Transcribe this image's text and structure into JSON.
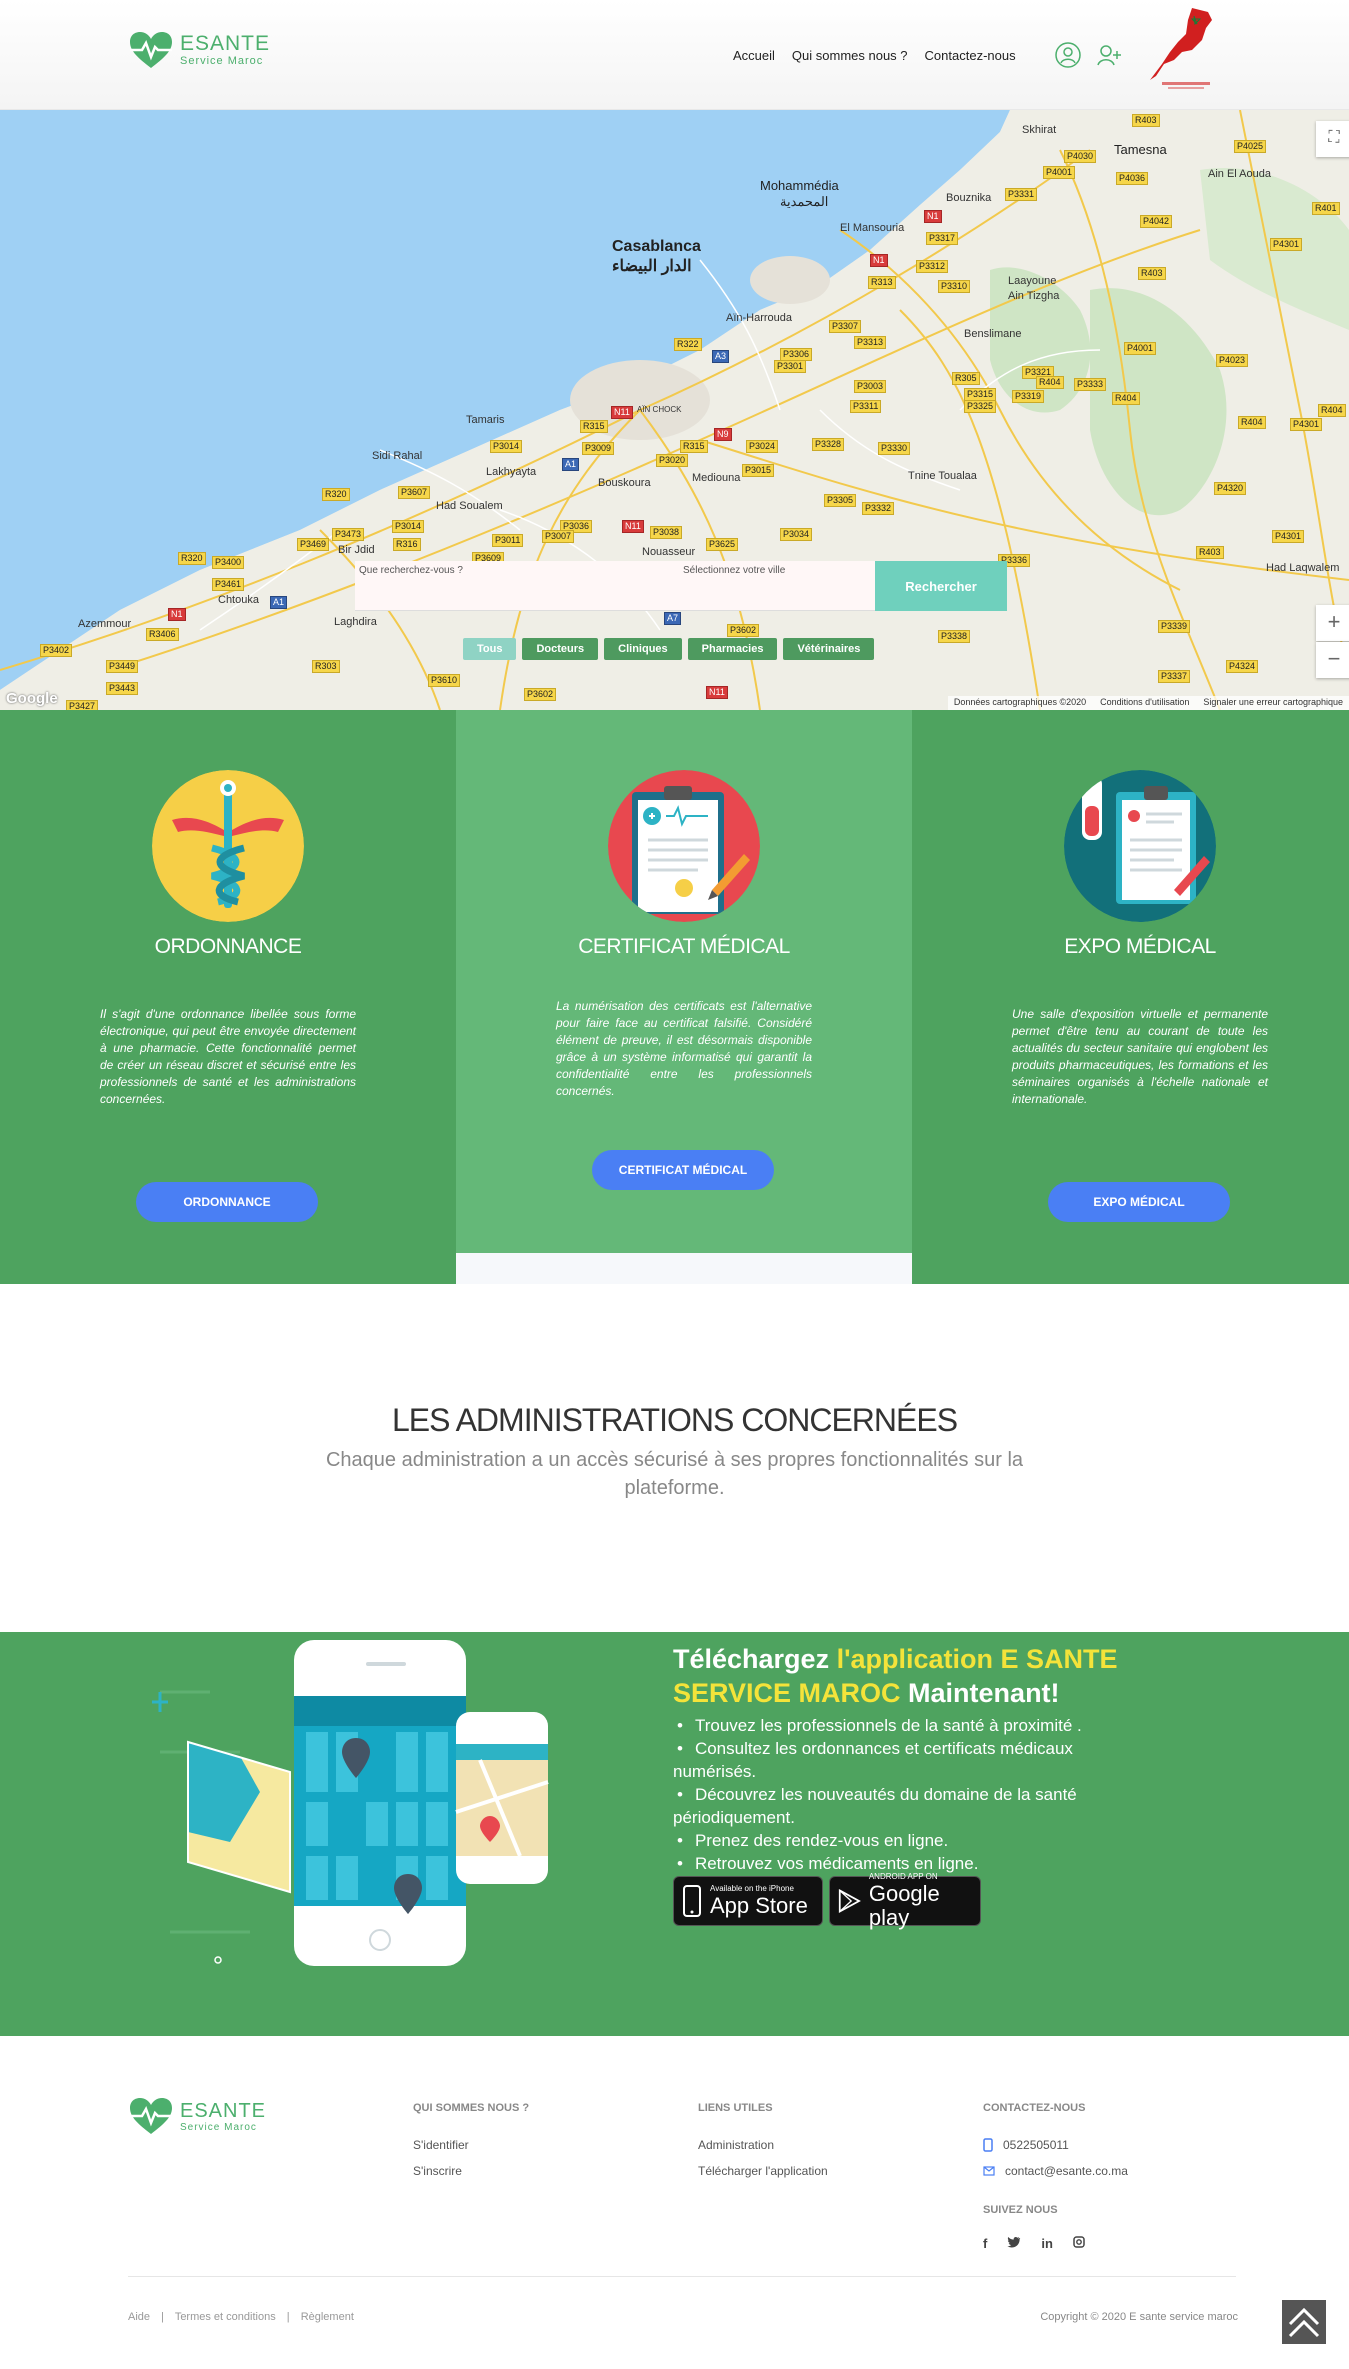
{
  "header": {
    "logo_name": "ESANTE",
    "logo_sub": "Service Maroc",
    "nav": [
      "Accueil",
      "Qui sommes nous ?",
      "Contactez-nous"
    ],
    "icons": [
      "user-icon",
      "add-user-icon"
    ]
  },
  "map": {
    "search_placeholder": "Que recherchez-vous ?",
    "city_placeholder": "Sélectionnez votre ville",
    "search_button": "Rechercher",
    "filters": [
      "Tous",
      "Docteurs",
      "Cliniques",
      "Pharmacies",
      "Vétérinaires"
    ],
    "active_filter": "Tous",
    "footer": [
      "Données cartographiques ©2020",
      "Conditions d'utilisation",
      "Signaler une erreur cartographique"
    ],
    "google": "Google",
    "places": {
      "casablanca": "Casablanca",
      "casablanca_ar": "الدار البيضاء",
      "mohammedia": "Mohammédia",
      "mohammedia_ar": "المحمدية",
      "skhirat": "Skhirat",
      "tamesna": "Tamesna",
      "bouznika": "Bouznika",
      "el_mansouria": "El Mansouria",
      "ain_harrouda": "Aïn-Harrouda",
      "laayoune": "Laayoune",
      "ain_tizgha": "Ain Tizgha",
      "benslimane": "Benslimane",
      "tamaris": "Tamaris",
      "sidi_rahal": "Sidi Rahal",
      "lakhyayta": "Lakhyayta",
      "bouskoura": "Bouskoura",
      "mediouna": "Mediouna",
      "had_soualem": "Had Soualem",
      "nouasseur": "Nouasseur",
      "tnine_toualaa": "Tnine Toualaa",
      "chtouka": "Chtouka",
      "azemmour": "Azemmour",
      "laghdira": "Laghdira",
      "bir_jdid": "Bir Jdid",
      "ain_el_aouda": "Ain El Aouda",
      "had_laqwalem": "Had Laqwalem",
      "ain_chock": "AÏN CHOCK"
    }
  },
  "features": [
    {
      "title": "ORDONNANCE",
      "text": "Il s'agit d'une ordonnance libellée sous forme électronique, qui peut être envoyée directement à une pharmacie. Cette fonctionnalité permet de créer un réseau discret et sécurisé entre les professionnels de santé et les administrations concernées.",
      "button": "ORDONNANCE",
      "color": "#f6cf47"
    },
    {
      "title": "CERTIFICAT MÉDICAL",
      "text": "La numérisation des certificats est l'alternative pour faire face au certificat falsifié. Considéré élément de preuve, il est désormais disponible grâce à un système informatisé qui garantit la confidentialité entre les professionnels concernés.",
      "button": "CERTIFICAT MÉDICAL",
      "color": "#e8484f"
    },
    {
      "title": "EXPO MÉDICAL",
      "text": "Une salle d'exposition virtuelle et permanente permet d'être tenu au courant de toute les actualités du secteur sanitaire qui englobent les produits pharmaceutiques, les formations et les séminaires organisés à l'échelle nationale et internationale.",
      "button": "EXPO MÉDICAL",
      "color": "#12707a"
    }
  ],
  "admin": {
    "title": "LES ADMINISTRATIONS CONCERNÉES",
    "subtitle": "Chaque administration a un accès sécurisé à ses propres fonctionnalités sur la plateforme."
  },
  "app": {
    "title_pre": "Téléchargez ",
    "title_hl": "l'application E SANTE SERVICE MAROC",
    "title_post": " Maintenant!",
    "bullets": [
      "Trouvez les professionnels de la santé à proximité .",
      "Consultez les ordonnances et certificats médicaux numérisés.",
      "Découvrez les nouveautés du domaine de la santé périodiquement.",
      "Prenez des rendez-vous en ligne.",
      "Retrouvez vos médicaments en ligne."
    ],
    "appstore_small": "Available on the iPhone",
    "appstore_big": "App Store",
    "gplay_small": "ANDROID APP ON",
    "gplay_big": "Google play"
  },
  "footer": {
    "logo_name": "ESANTE",
    "logo_sub": "Service Maroc",
    "col1_title": "QUI SOMMES NOUS ?",
    "col1_links": [
      "S'identifier",
      "S'inscrire"
    ],
    "col2_title": "LIENS UTILES",
    "col2_links": [
      "Administration",
      "Télécharger l'application"
    ],
    "col3_title": "CONTACTEZ-NOUS",
    "phone": "0522505011",
    "email": "contact@esante.co.ma",
    "social_title": "SUIVEZ NOUS",
    "social": [
      "f",
      "t",
      "in",
      "ig"
    ],
    "bottom_links": [
      "Aide",
      "Termes et conditions",
      "Règlement"
    ],
    "copyright": "Copyright © 2020 E sante service maroc"
  }
}
